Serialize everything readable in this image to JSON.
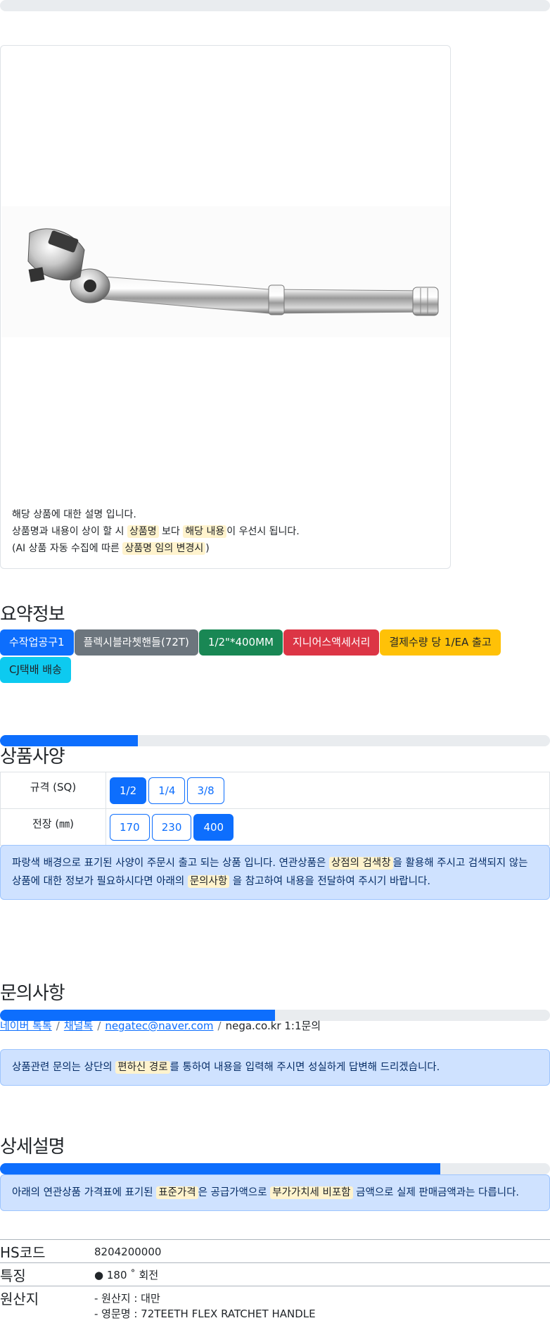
{
  "card": {
    "desc_line1": "해당 상품에 대한 설명 입니다.",
    "desc_line2_a": "상품명과 내용이 상이 할 시 ",
    "desc_line2_mark1": "상품명",
    "desc_line2_b": " 보다 ",
    "desc_line2_mark2": "해당 내용",
    "desc_line2_c": "이 우선시 됩니다.",
    "desc_line3_a": "(AI 상품 자동 수집에 따른 ",
    "desc_line3_mark": "상품명 임의 변경시",
    "desc_line3_b": ")"
  },
  "summary": {
    "title": "요약정보",
    "badges": [
      "수작업공구1",
      "플렉시블라쳇핸들(72T)",
      "1/2\"*400MM",
      "지니어스액세서리",
      "결제수량 당 1/EA 출고",
      "CJ택배 배송"
    ]
  },
  "specs": {
    "title": "상품사양",
    "progress_percent": 25,
    "rows": [
      {
        "label": "규격 (SQ)",
        "options": [
          "1/2",
          "1/4",
          "3/8"
        ],
        "selected": "1/2"
      },
      {
        "label": "전장 (㎜)",
        "options": [
          "170",
          "230",
          "400"
        ],
        "selected": "400"
      }
    ],
    "note_a": "파랑색 배경으로 표기된 사양이 주문시 출고 되는 상품 입니다. 연관상품은 ",
    "note_mark1": "상점의 검색창",
    "note_b": "을 활용해 주시고 검색되지 않는 상품에 대한 정보가 필요하시다면 아래의 ",
    "note_mark2": "문의사항",
    "note_c": " 을 참고하여 내용을 전달하여 주시기 바랍니다."
  },
  "inquiry": {
    "title": "문의사항",
    "progress_percent": 50,
    "links": [
      "네이버 톡톡",
      "채널톡",
      "negatec@naver.com"
    ],
    "plain": "nega.co.kr 1:1문의",
    "note_a": "상품관련 문의는 상단의 ",
    "note_mark": "편하신 경로",
    "note_b": "를 통하여 내용을 입력해 주시면 성실하게 답변해 드리겠습니다."
  },
  "detail": {
    "title": "상세설명",
    "progress_percent": 80,
    "note_a": "아래의 연관상품 가격표에 표기된 ",
    "note_mark1": "표준가격",
    "note_b": "은 공급가액으로 ",
    "note_mark2": "부가가치세 비포함",
    "note_c": " 금액으로 실제 판매금액과는 다릅니다.",
    "rows": [
      {
        "key": "HS코드",
        "value": "8204200000"
      },
      {
        "key": "특징",
        "value": "● 180 ˚ 회전"
      },
      {
        "key": "원산지",
        "value": "- 원산지 : 대만",
        "value2": "- 영문명 : 72TEETH FLEX RATCHET HANDLE"
      }
    ]
  },
  "colors": {
    "primary": "#0d6efd",
    "alert_bg": "#cfe2ff",
    "mark_bg": "#fff3cd"
  }
}
